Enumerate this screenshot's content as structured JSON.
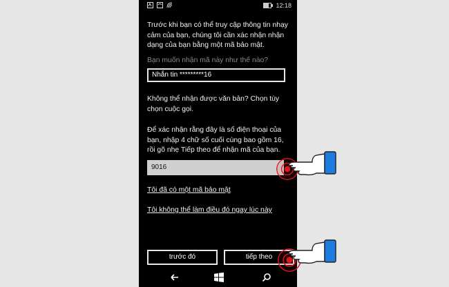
{
  "status": {
    "time": "12:18"
  },
  "intro": "Trước khi bạn có thể truy cập thông tin nhạy cảm của bạn, chúng tôi cần xác nhận nhận dạng của bạn bằng một mã bảo mật.",
  "method_prompt": "Bạn muốn nhận mã này như thế nào?",
  "method_value": "Nhắn tin *********16",
  "alt_text": "Không thể nhận được văn bản? Chọn tùy chọn cuộc gọi.",
  "instructions": "Để xác nhận rằng đây là số điện thoại của bạn, nhập 4 chữ số cuối cùng bao gồm 16, rồi gõ nhẹ Tiếp theo để nhận mã của bạn.",
  "code_value": "9016",
  "links": {
    "have_code": "Tôi đã có một mã bảo mật",
    "cant_now": "Tôi không thể làm điều đó ngay lúc này"
  },
  "buttons": {
    "back": "trước đó",
    "next": "tiếp theo"
  },
  "icons": {
    "back": "back-arrow-icon",
    "start": "windows-start-icon",
    "search": "search-icon",
    "hand": "pointing-hand-icon"
  },
  "colors": {
    "background": "#000000",
    "input": "#cfcfcf",
    "tap": "#e0161e",
    "hand_cuff": "#1e7be0"
  }
}
